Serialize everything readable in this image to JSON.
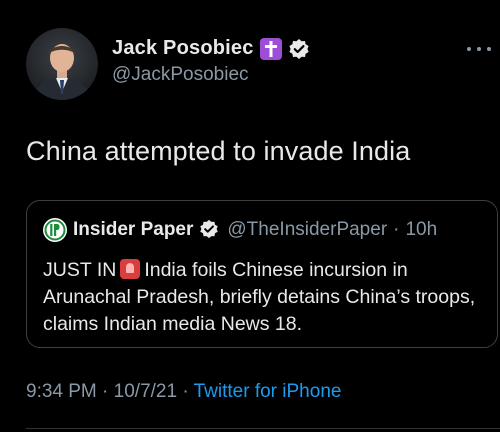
{
  "author": {
    "display_name": "Jack Posobiec",
    "handle": "@JackPosobiec",
    "badge_icons": [
      "cross-icon",
      "verified-icon"
    ]
  },
  "tweet": {
    "text": "China attempted to invade India"
  },
  "quoted_tweet": {
    "display_name": "Insider Paper",
    "handle": "@TheInsiderPaper",
    "separator": "·",
    "time": "10h",
    "text_prefix": "JUST IN",
    "text_body": "India foils Chinese incursion in Arunachal Pradesh, briefly detains China’s troops, claims Indian media News 18."
  },
  "meta": {
    "time": "9:34 PM",
    "separator": "·",
    "date": "10/7/21",
    "source": "Twitter for iPhone"
  },
  "colors": {
    "background": "#000000",
    "primary_text": "#e7e9ea",
    "secondary_text": "#8b98a5",
    "link": "#1d9bf0",
    "cross_badge": "#9c4fd6",
    "border": "#3a3f44"
  }
}
